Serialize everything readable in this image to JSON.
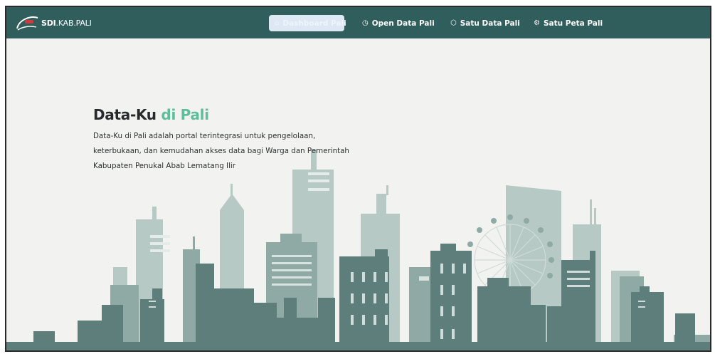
{
  "brand": {
    "bold": "SDI",
    "rest": ".KAB.PALI",
    "logo_icon": "swoosh-logo"
  },
  "nav": [
    {
      "label": "Dashboard Pali",
      "icon": "home-icon",
      "active": true
    },
    {
      "label": "Open Data Pali",
      "icon": "clock-icon",
      "active": false
    },
    {
      "label": "Satu Data Pali",
      "icon": "cube-icon",
      "active": false
    },
    {
      "label": "Satu Peta Pali",
      "icon": "gear-icon",
      "active": false
    }
  ],
  "hero": {
    "title_main": "Data-Ku",
    "title_accent": "di Pali",
    "description": "Data-Ku di Pali adalah portal terintegrasi untuk pengelolaan, keterbukaan, dan kemudahan akses data bagi Warga dan Pemerintah Kabupaten Penukal Abab Lematang Ilir"
  },
  "colors": {
    "navbar": "#2f5e5d",
    "accent": "#5ebe9b",
    "background": "#f2f2f0"
  }
}
